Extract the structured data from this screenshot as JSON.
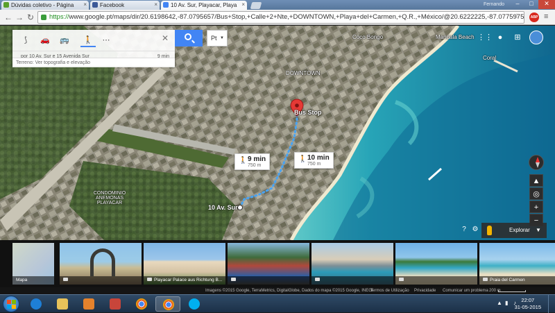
{
  "browser": {
    "tabs": [
      {
        "title": "Dúvidas coletivo - Página",
        "color": "#5aa02c"
      },
      {
        "title": "Facebook",
        "color": "#3b5998"
      },
      {
        "title": "10 Av. Sur, Playacar, Playa",
        "color": "#4285f4"
      }
    ],
    "url_scheme": "https://",
    "url_rest": "www.google.pt/maps/dir/20.6198642,-87.0795657/Bus+Stop,+Calle+2+Nte,+DOWNTOWN,+Playa+del+Carmen,+Q.R.,+México/@20.6222225,-87.0775975,",
    "profile_label": "Fernando",
    "abp_label": "ABP",
    "nav": {
      "back": "←",
      "forward": "→",
      "reload": "↻"
    }
  },
  "directions": {
    "modes": [
      {
        "name": "best-route",
        "glyph": "⟆"
      },
      {
        "name": "car",
        "glyph": "🚗"
      },
      {
        "name": "transit",
        "glyph": "🚌"
      },
      {
        "name": "walk",
        "glyph": "🚶"
      },
      {
        "name": "more",
        "glyph": "⋯"
      }
    ],
    "selected_mode": "walk",
    "summary_via": "por 10 Av. Sur e 15 Avenida Sur",
    "summary_time": "9 min",
    "close": "✕",
    "language": "Pt",
    "terrain_label": "Terreno",
    "terrain_hint": "Ver topografia e elevação"
  },
  "map": {
    "labels": [
      {
        "text": "Coco Bongo",
        "big": false
      },
      {
        "text": "DOWNTOWN",
        "big": false
      },
      {
        "text": "Mandala Beach",
        "big": false
      },
      {
        "text": "Coral",
        "big": false
      },
      {
        "text": "CONDOMINIO ANEMONAS PLAYACAR",
        "big": false
      },
      {
        "text": "Bus Stop",
        "big": true
      },
      {
        "text": "10 Av. Sur",
        "big": true
      }
    ],
    "route_callouts": [
      {
        "time": "9 min",
        "distance": "750 m"
      },
      {
        "time": "10 min",
        "distance": "750 m"
      }
    ],
    "explore_label": "Explorar",
    "help": "?",
    "settings": "⚙",
    "zoom_in": "+",
    "zoom_out": "−",
    "colors": {
      "route": "#4aa3f0",
      "pin": "#e53935",
      "sea": "#2aa7b8",
      "deep_sea": "#0f6a93"
    }
  },
  "photos": [
    {
      "caption": "Mapa"
    },
    {
      "caption": ""
    },
    {
      "caption": "Playacar Palace aus Richtung B..."
    },
    {
      "caption": ""
    },
    {
      "caption": ""
    },
    {
      "caption": ""
    },
    {
      "caption": "Praia del Carmen"
    }
  ],
  "attribution": [
    "Imagens ©2015 Google, TerraMetrics, DigitalGlobe, Dados do mapa ©2015 Google, INEGI",
    "Termos de Utilização",
    "Privacidade",
    "Comunicar um problema",
    "200 m"
  ],
  "taskbar": {
    "time": "22:07",
    "date": "31-05-2015",
    "apps": [
      "internet-explorer",
      "file-explorer",
      "media-player",
      "tool",
      "chrome",
      "chrome-active",
      "skype"
    ]
  }
}
